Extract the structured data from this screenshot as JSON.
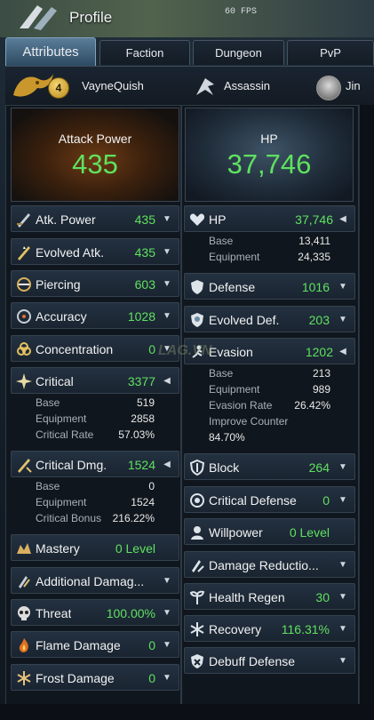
{
  "header": {
    "title": "Profile",
    "fps": "60 FPS"
  },
  "tabs": [
    {
      "label": "Attributes",
      "active": true
    },
    {
      "label": "Faction"
    },
    {
      "label": "Dungeon"
    },
    {
      "label": "PvP"
    }
  ],
  "character": {
    "level": "4",
    "name": "VayneQuish",
    "class": "Assassin",
    "faction": "Jin"
  },
  "attack_power": {
    "label": "Attack Power",
    "value": "435"
  },
  "hp_panel": {
    "label": "HP",
    "value": "37,746"
  },
  "left": {
    "atk_power": {
      "name": "Atk. Power",
      "value": "435"
    },
    "evolved_atk": {
      "name": "Evolved Atk.",
      "value": "435"
    },
    "piercing": {
      "name": "Piercing",
      "value": "603"
    },
    "accuracy": {
      "name": "Accuracy",
      "value": "1028"
    },
    "concentration": {
      "name": "Concentration",
      "value": "0"
    },
    "critical": {
      "name": "Critical",
      "value": "3377",
      "details": [
        {
          "label": "Base",
          "value": "519"
        },
        {
          "label": "Equipment",
          "value": "2858"
        },
        {
          "label": "Critical Rate",
          "value": "57.03%"
        }
      ]
    },
    "critical_dmg": {
      "name": "Critical Dmg.",
      "value": "1524",
      "details": [
        {
          "label": "Base",
          "value": "0"
        },
        {
          "label": "Equipment",
          "value": "1524"
        },
        {
          "label": "Critical Bonus",
          "value": "216.22%"
        }
      ]
    },
    "mastery": {
      "name": "Mastery",
      "value": "0 Level"
    },
    "additional_damage": {
      "name": "Additional Damag...",
      "value": ""
    },
    "threat": {
      "name": "Threat",
      "value": "100.00%"
    },
    "flame_damage": {
      "name": "Flame Damage",
      "value": "0"
    },
    "frost_damage": {
      "name": "Frost Damage",
      "value": "0"
    }
  },
  "right": {
    "hp": {
      "name": "HP",
      "value": "37,746",
      "details": [
        {
          "label": "Base",
          "value": "13,411"
        },
        {
          "label": "Equipment",
          "value": "24,335"
        }
      ]
    },
    "defense": {
      "name": "Defense",
      "value": "1016"
    },
    "evolved_def": {
      "name": "Evolved Def.",
      "value": "203"
    },
    "evasion": {
      "name": "Evasion",
      "value": "1202",
      "details": [
        {
          "label": "Base",
          "value": "213"
        },
        {
          "label": "Equipment",
          "value": "989"
        },
        {
          "label": "Evasion Rate",
          "value": "26.42%"
        },
        {
          "label": "Improve Counter",
          "value": "84.70%"
        }
      ]
    },
    "block": {
      "name": "Block",
      "value": "264"
    },
    "critical_defense": {
      "name": "Critical Defense",
      "value": "0"
    },
    "willpower": {
      "name": "Willpower",
      "value": "0 Level"
    },
    "damage_reduction": {
      "name": "Damage Reductio...",
      "value": ""
    },
    "health_regen": {
      "name": "Health Regen",
      "value": "30"
    },
    "recovery": {
      "name": "Recovery",
      "value": "116.31%"
    },
    "debuff_defense": {
      "name": "Debuff Defense",
      "value": ""
    }
  },
  "watermark": "LAG.VN"
}
